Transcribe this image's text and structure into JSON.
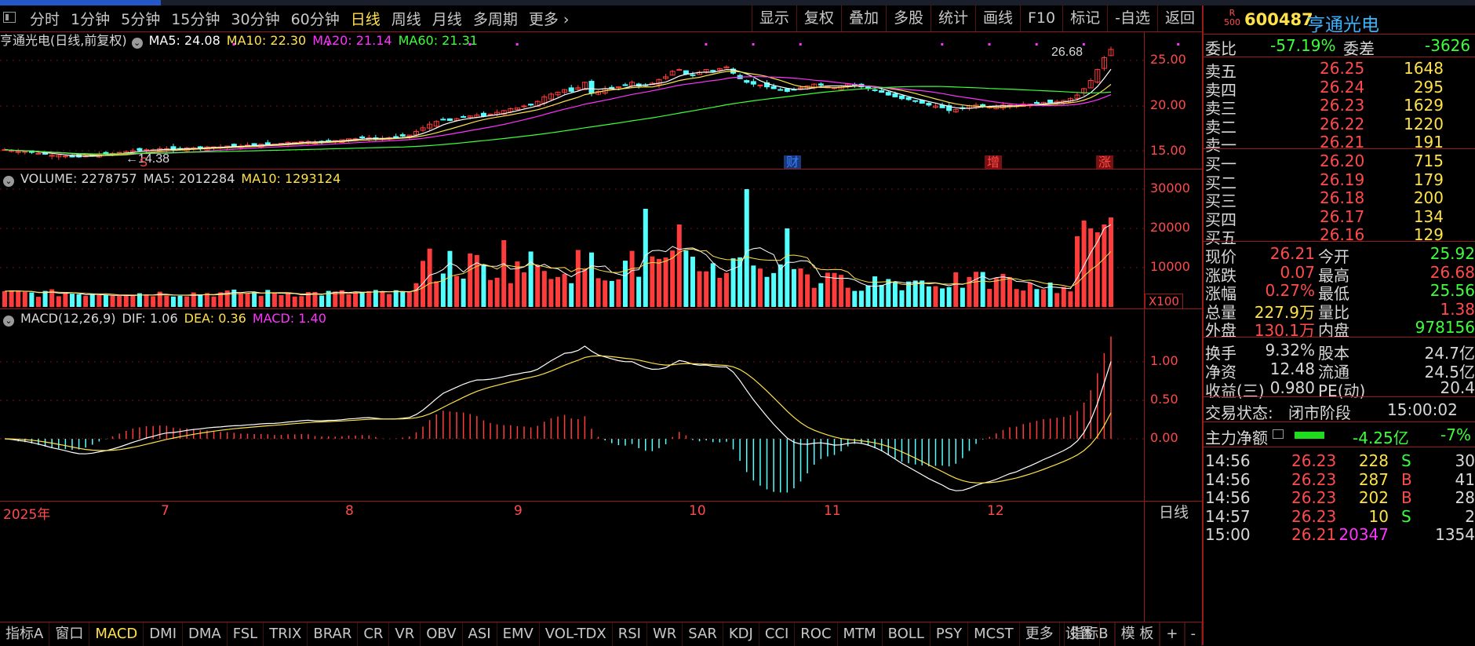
{
  "toolbar": {
    "periods": [
      "分时",
      "1分钟",
      "5分钟",
      "15分钟",
      "30分钟",
      "60分钟",
      "日线",
      "周线",
      "月线",
      "多周期",
      "更多"
    ],
    "active_period": "日线",
    "actions": [
      "显示",
      "复权",
      "叠加",
      "多股",
      "统计",
      "画线",
      "F10",
      "标记",
      "-自选",
      "返回"
    ]
  },
  "price_pane": {
    "title": "亨通光电(日线,前复权)",
    "ma": [
      {
        "label": "MA5: 24.08",
        "color": "#ffffff"
      },
      {
        "label": "MA10: 22.30",
        "color": "#ffe14a"
      },
      {
        "label": "MA20: 21.14",
        "color": "#ff33ff"
      },
      {
        "label": "MA60: 21.31",
        "color": "#3cff3c"
      }
    ],
    "y_ticks": [
      "25.00",
      "20.00",
      "15.00"
    ],
    "high_label": "26.68",
    "low_label": "14.38",
    "event_markers": [
      {
        "text": "S",
        "color": "#ff4b4b"
      },
      {
        "text": "财",
        "color": "#3a7bff"
      },
      {
        "text": "增",
        "color": "#ff4b4b"
      },
      {
        "text": "涨",
        "color": "#ff4b4b"
      }
    ]
  },
  "volume_pane": {
    "legend": [
      {
        "label": "VOLUME: 2278757",
        "color": "#d8d8d8"
      },
      {
        "label": "MA5: 2012284",
        "color": "#d8d8d8"
      },
      {
        "label": "MA10: 1293124",
        "color": "#ffe14a"
      }
    ],
    "y_ticks": [
      "30000",
      "20000",
      "10000"
    ],
    "unit": "X100"
  },
  "macd_pane": {
    "legend": [
      {
        "label": "MACD(12,26,9)",
        "color": "#d8d8d8"
      },
      {
        "label": "DIF: 1.06",
        "color": "#d8d8d8"
      },
      {
        "label": "DEA: 0.36",
        "color": "#ffe14a"
      },
      {
        "label": "MACD: 1.40",
        "color": "#ff33ff"
      }
    ],
    "y_ticks": [
      "1.00",
      "0.50",
      "0.00"
    ]
  },
  "date_axis": [
    "2025年",
    "7",
    "8",
    "9",
    "10",
    "11",
    "12"
  ],
  "period_label": "日线",
  "indicators": [
    "指标A",
    "窗口",
    "MACD",
    "DMI",
    "DMA",
    "FSL",
    "TRIX",
    "BRAR",
    "CR",
    "VR",
    "OBV",
    "ASI",
    "EMV",
    "VOL-TDX",
    "RSI",
    "WR",
    "SAR",
    "KDJ",
    "CCI",
    "ROC",
    "MTM",
    "BOLL",
    "PSY",
    "MCST",
    "更多",
    "设置"
  ],
  "active_indicator": "MACD",
  "indicator_right": [
    "指标B",
    "模 板",
    "+",
    "-"
  ],
  "quote": {
    "rank_badge": "R\n500",
    "code": "600487",
    "name": "亨通光电",
    "webi": {
      "label": "委比",
      "value": "-57.19%",
      "label2": "委差",
      "value2": "-3626"
    },
    "asks": [
      {
        "label": "卖五",
        "price": "26.25",
        "vol": "1648"
      },
      {
        "label": "卖四",
        "price": "26.24",
        "vol": "295"
      },
      {
        "label": "卖三",
        "price": "26.23",
        "vol": "1629"
      },
      {
        "label": "卖二",
        "price": "26.22",
        "vol": "1220"
      },
      {
        "label": "卖一",
        "price": "26.21",
        "vol": "191"
      }
    ],
    "bids": [
      {
        "label": "买一",
        "price": "26.20",
        "vol": "715"
      },
      {
        "label": "买二",
        "price": "26.19",
        "vol": "179"
      },
      {
        "label": "买三",
        "price": "26.18",
        "vol": "200"
      },
      {
        "label": "买四",
        "price": "26.17",
        "vol": "134"
      },
      {
        "label": "买五",
        "price": "26.16",
        "vol": "129"
      }
    ],
    "stats": [
      {
        "l1": "现价",
        "v1": "26.21",
        "c1": "red",
        "l2": "今开",
        "v2": "25.92",
        "c2": "grn"
      },
      {
        "l1": "涨跌",
        "v1": "0.07",
        "c1": "red",
        "l2": "最高",
        "v2": "26.68",
        "c2": "red"
      },
      {
        "l1": "涨幅",
        "v1": "0.27%",
        "c1": "red",
        "l2": "最低",
        "v2": "25.56",
        "c2": "grn"
      },
      {
        "l1": "总量",
        "v1": "227.9万",
        "c1": "yel",
        "l2": "量比",
        "v2": "1.38",
        "c2": "red"
      },
      {
        "l1": "外盘",
        "v1": "130.1万",
        "c1": "red",
        "l2": "内盘",
        "v2": "978156",
        "c2": "grn"
      }
    ],
    "stats2": [
      {
        "l1": "换手",
        "v1": "9.32%",
        "l2": "股本",
        "v2": "24.7亿"
      },
      {
        "l1": "净资",
        "v1": "12.48",
        "l2": "流通",
        "v2": "24.5亿"
      },
      {
        "l1": "收益(三)",
        "v1": "0.980",
        "l2": "PE(动)",
        "v2": "20.4"
      }
    ],
    "trade_status_label": "交易状态:",
    "trade_status": "闭市阶段",
    "trade_time": "15:00:02",
    "main_flow_label": "主力净额",
    "main_flow_value": "-4.25亿",
    "main_flow_pct": "-7%",
    "ticks": [
      {
        "time": "14:56",
        "price": "26.23",
        "vol": "228",
        "side": "S",
        "extra": "30"
      },
      {
        "time": "14:56",
        "price": "26.23",
        "vol": "287",
        "side": "B",
        "extra": "41"
      },
      {
        "time": "14:56",
        "price": "26.23",
        "vol": "202",
        "side": "B",
        "extra": "28"
      },
      {
        "time": "14:57",
        "price": "26.23",
        "vol": "10",
        "side": "S",
        "extra": "2"
      },
      {
        "time": "15:00",
        "price": "26.21",
        "vol": "20347",
        "side": "",
        "extra": "1354"
      }
    ]
  },
  "chart_data": {
    "type": "candlestick",
    "title": "亨通光电(日线,前复权)",
    "price_range": [
      13.5,
      27.5
    ],
    "close_series_approx": [
      15.2,
      15.1,
      15.0,
      15.0,
      14.9,
      14.8,
      14.7,
      14.6,
      14.6,
      14.5,
      14.4,
      14.4,
      14.5,
      14.6,
      14.7,
      14.7,
      14.8,
      14.9,
      15.0,
      15.1,
      15.1,
      15.2,
      15.2,
      15.3,
      15.3,
      15.2,
      15.3,
      15.4,
      15.4,
      15.4,
      15.5,
      15.5,
      15.5,
      15.6,
      15.6,
      15.6,
      15.7,
      15.7,
      15.8,
      15.8,
      15.8,
      15.9,
      16.0,
      16.0,
      16.1,
      16.1,
      16.0,
      16.1,
      16.2,
      16.2,
      16.3,
      16.4,
      16.4,
      16.5,
      16.5,
      16.4,
      16.4,
      16.5,
      16.6,
      16.7,
      16.8,
      17.2,
      17.6,
      18.0,
      18.3,
      18.5,
      18.4,
      18.6,
      18.8,
      18.9,
      19.0,
      18.9,
      19.1,
      19.3,
      19.5,
      19.7,
      19.8,
      20.0,
      20.1,
      20.5,
      21.0,
      21.3,
      21.5,
      21.8,
      21.6,
      22.0,
      22.6,
      21.4,
      21.6,
      21.9,
      22.0,
      22.1,
      22.3,
      22.6,
      22.2,
      22.3,
      22.5,
      22.9,
      23.2,
      23.8,
      24.0,
      23.5,
      23.4,
      23.7,
      24.0,
      23.9,
      24.1,
      24.3,
      23.6,
      23.0,
      22.6,
      22.4,
      22.3,
      22.1,
      21.9,
      21.8,
      21.6,
      21.8,
      22.0,
      22.2,
      22.4,
      22.3,
      22.1,
      22.0,
      22.2,
      22.4,
      22.3,
      22.1,
      21.9,
      21.7,
      21.5,
      21.2,
      21.0,
      20.8,
      20.7,
      20.5,
      20.3,
      20.1,
      20.0,
      19.8,
      19.5,
      19.6,
      19.8,
      20.0,
      20.1,
      20.0,
      19.9,
      20.0,
      20.1,
      20.1,
      20.0,
      20.2,
      20.2,
      20.3,
      20.4,
      20.4,
      20.5,
      20.6,
      20.8,
      21.2,
      21.9,
      22.8,
      24.0,
      25.3,
      26.21
    ],
    "ma": {
      "MA5": 24.08,
      "MA10": 22.3,
      "MA20": 21.14,
      "MA60": 21.31
    },
    "macd_latest": {
      "DIF": 1.06,
      "DEA": 0.36,
      "MACD": 1.4
    },
    "volume_latest": 2278757
  }
}
